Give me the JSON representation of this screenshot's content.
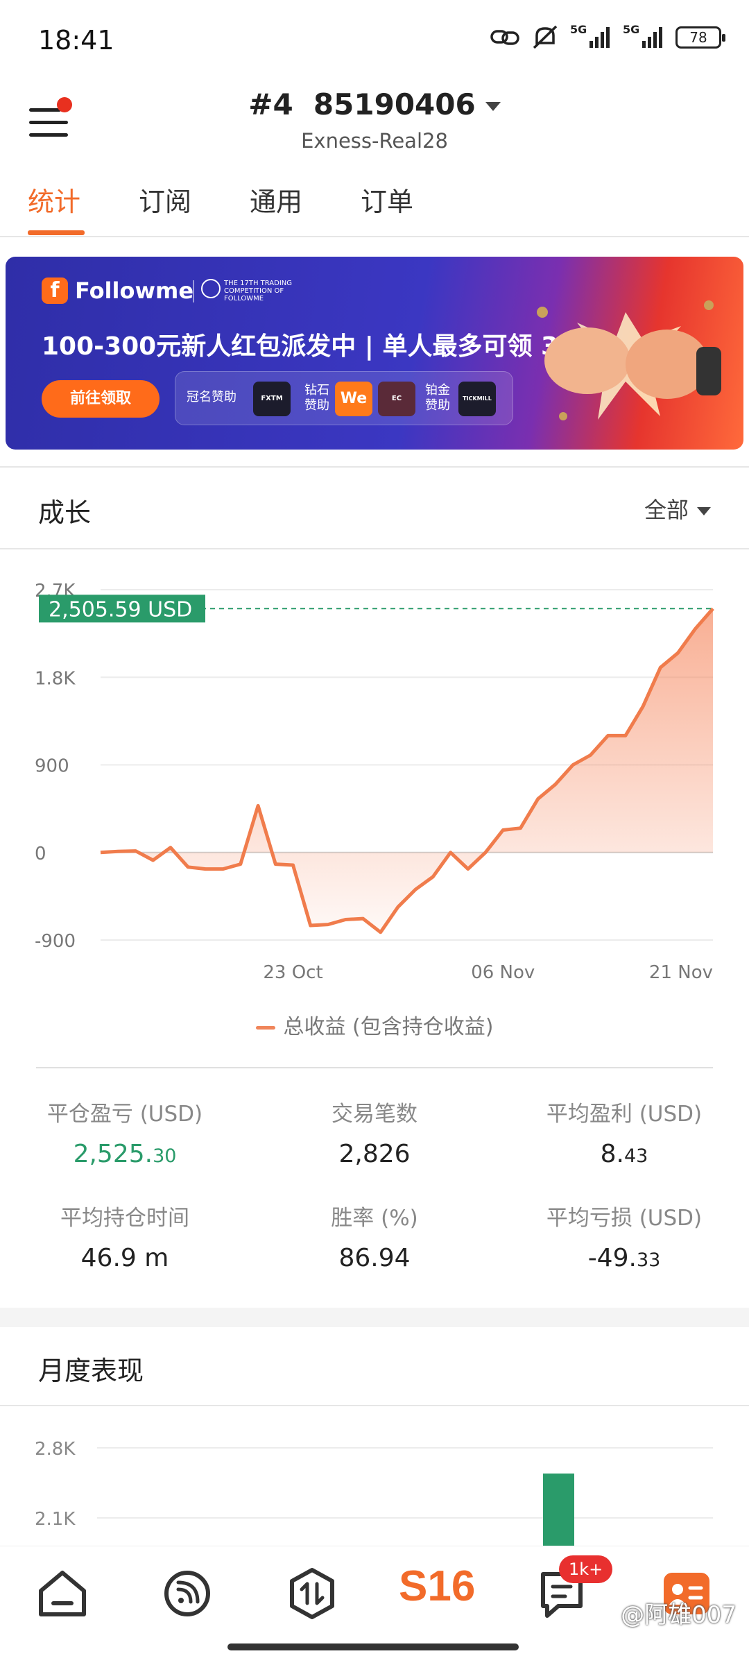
{
  "status_bar": {
    "time": "18:41",
    "battery": "78",
    "signal_1": "5G",
    "signal_2": "5G"
  },
  "header": {
    "account": "#4  85190406",
    "server": "Exness-Real28"
  },
  "tabs": [
    {
      "label": "统计"
    },
    {
      "label": "订阅"
    },
    {
      "label": "通用"
    },
    {
      "label": "订单"
    }
  ],
  "banner": {
    "brand": "Followme",
    "competition": "THE 17TH TRADING COMPETITION OF FOLLOWME",
    "headline": "100-300元新人红包派发中 | 单人最多可领 3 份",
    "cta": "前往领取",
    "sponsor_title": "冠名赞助",
    "sponsor_diamond": "钻石赞助",
    "sponsor_platinum": "铂金赞助",
    "logos": {
      "fxtm": "FXTM",
      "we": "We",
      "ec": "EC",
      "tickmill": "TICKMILL"
    }
  },
  "growth": {
    "title": "成长",
    "filter": "全部",
    "current_label": "2,505.59 USD"
  },
  "chart_data": {
    "type": "area",
    "title": "",
    "x_ticks": [
      "23 Oct",
      "06 Nov",
      "21 Nov"
    ],
    "y_ticks": [
      "2.7K",
      "1.8K",
      "900",
      "0",
      "-900"
    ],
    "ylim": [
      -900,
      2700
    ],
    "grid": true,
    "legend": "总收益 (包含持仓收益)",
    "series": [
      {
        "name": "总收益 (包含持仓收益)",
        "values": [
          0,
          10,
          15,
          -80,
          50,
          -150,
          -170,
          -170,
          -120,
          480,
          -120,
          -130,
          -750,
          -740,
          -690,
          -680,
          -820,
          -560,
          -380,
          -250,
          0,
          -170,
          0,
          230,
          250,
          550,
          700,
          900,
          1000,
          1200,
          1200,
          1500,
          1900,
          2050,
          2300,
          2505.59
        ]
      }
    ],
    "last_value": 2505.59,
    "line_color": "#f07c4c"
  },
  "stats": [
    {
      "label": "平仓盈亏 (USD)",
      "val_main": "2,525.",
      "val_small": "30"
    },
    {
      "label": "交易笔数",
      "val_main": "2,826",
      "val_small": ""
    },
    {
      "label": "平均盈利 (USD)",
      "val_main": "8.",
      "val_small": "43"
    },
    {
      "label": "平均持仓时间",
      "val_main": "46.9 m",
      "val_small": ""
    },
    {
      "label": "胜率 (%)",
      "val_main": "86.94",
      "val_small": ""
    },
    {
      "label": "平均亏损 (USD)",
      "val_main": "-49.",
      "val_small": "33"
    }
  ],
  "monthly": {
    "title": "月度表现",
    "y_ticks": [
      "2.8K",
      "2.1K"
    ],
    "bar_value": 2505,
    "bar_color": "#2a9b6a"
  },
  "bottom_nav": {
    "badge": "1k+",
    "s16_label": "S16",
    "watermark": "@阿雄007"
  }
}
